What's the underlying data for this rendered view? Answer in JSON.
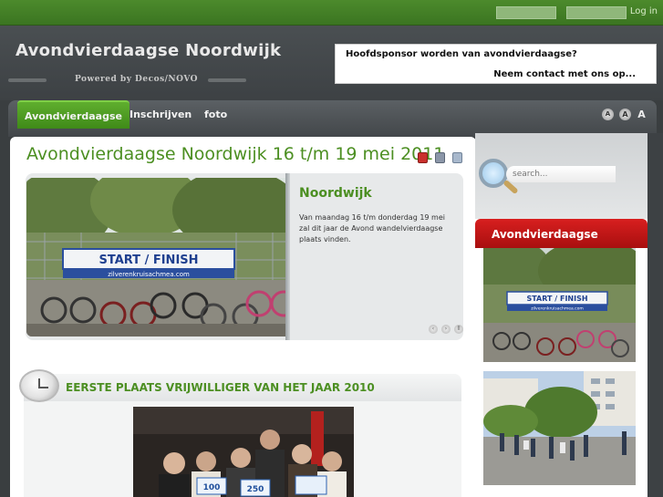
{
  "topbar": {
    "login_label": "Log in"
  },
  "header": {
    "site_title": "Avondvierdaagse Noordwijk",
    "powered_by": "Powered by Decos/NOVO",
    "sponsor_line1": "Hoofdsponsor worden van avondvierdaagse?",
    "sponsor_line2": "Neem contact met ons op..."
  },
  "nav": {
    "items": [
      {
        "label": "Avondvierdaagse",
        "active": true
      },
      {
        "label": "Inschrijven",
        "active": false
      },
      {
        "label": "foto",
        "active": false
      }
    ],
    "font_sizes": [
      "A",
      "A",
      "A"
    ]
  },
  "main": {
    "heading": "Avondvierdaagse Noordwijk 16 t/m 19 mei 2011",
    "tools": [
      "pdf-icon",
      "print-icon",
      "email-icon"
    ],
    "feature": {
      "banner_text": "START / FINISH",
      "banner_subtext": "zilverenkruisachmea.com",
      "title": "Noordwijk",
      "text": "Van maandag 16 t/m donderdag 19 mei zal dit jaar de Avond wandelvierdaagse plaats vinden.",
      "pager": [
        "‹",
        "›",
        "ll"
      ]
    },
    "article": {
      "title": "EERSTE PLAATS VRIJWILLIGER VAN HET JAAR 2010",
      "sign_values": [
        "100",
        "250"
      ]
    }
  },
  "sidebar": {
    "search_placeholder": "search...",
    "heading": "Avondvierdaagse",
    "banner_text": "START / FINISH",
    "banner_subtext": "zilverenkruisachmea.com"
  },
  "colors": {
    "brand_green": "#4c8f22",
    "nav_active": "#4f9e24",
    "side_heading_red": "#c41717",
    "topbar_green": "#447f27"
  }
}
